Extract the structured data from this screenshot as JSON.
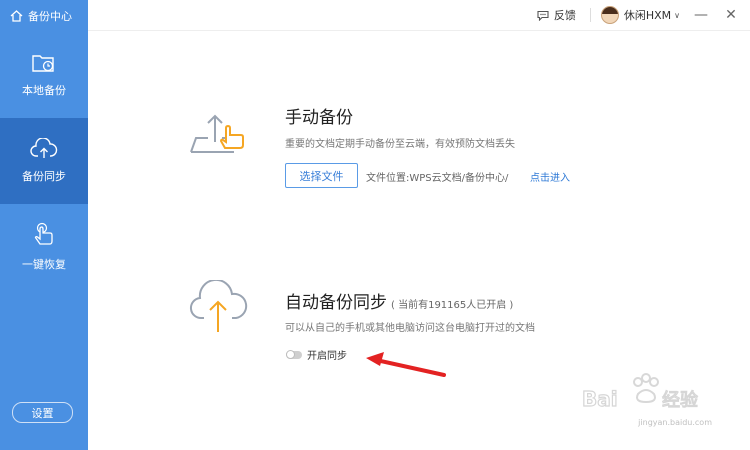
{
  "app": {
    "title": "备份中心"
  },
  "sidebar": {
    "items": [
      {
        "label": "本地备份",
        "icon": "folder-clock-icon"
      },
      {
        "label": "备份同步",
        "icon": "cloud-upload-icon",
        "active": true
      },
      {
        "label": "一键恢复",
        "icon": "hand-pointer-icon"
      }
    ],
    "settings_label": "设置"
  },
  "topbar": {
    "feedback_label": "反馈",
    "username": "休闲HXM",
    "minimize": "—",
    "close": "✕"
  },
  "manual_backup": {
    "title": "手动备份",
    "description": "重要的文档定期手动备份至云端，有效预防文档丢失",
    "button_label": "选择文件",
    "file_location": "文件位置:WPS云文档/备份中心/",
    "link_label": "点击进入"
  },
  "auto_backup": {
    "title": "自动备份同步",
    "subtitle": "( 当前有191165人已开启 )",
    "description": "可以从自己的手机或其他电脑访问这台电脑打开过的文档",
    "toggle_label": "开启同步",
    "toggle_on": false
  },
  "watermark": {
    "url": "jingyan.baidu.com"
  },
  "colors": {
    "sidebar": "#4a90e2",
    "sidebar_active": "#2f6fc2",
    "accent": "#f5a623",
    "arrow": "#e32222"
  }
}
